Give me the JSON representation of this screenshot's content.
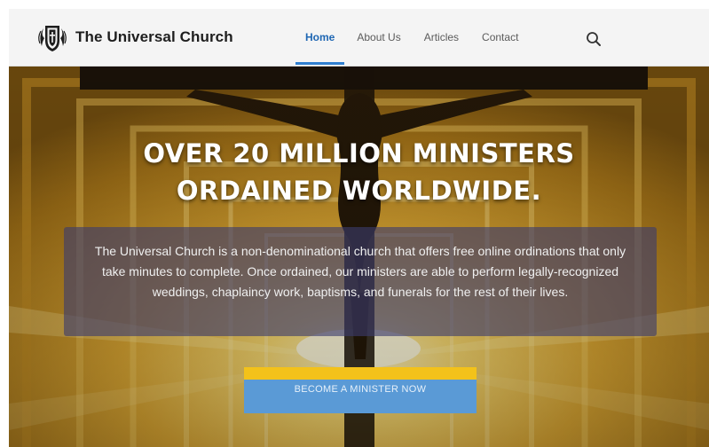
{
  "header": {
    "brand": "The Universal Church",
    "nav": [
      {
        "label": "Home",
        "active": true
      },
      {
        "label": "About Us",
        "active": false
      },
      {
        "label": "Articles",
        "active": false
      },
      {
        "label": "Contact",
        "active": false
      }
    ],
    "search_icon": "search-icon",
    "logo_icon": "church-crest-icon"
  },
  "hero": {
    "headline_line1": "OVER 20 MILLION MINISTERS",
    "headline_line2": "ORDAINED WORLDWIDE.",
    "description": "The Universal Church is a non-denominational church that offers free online ordinations that only take minutes to complete. Once ordained, our ministers are able to perform legally-recognized weddings, chaplaincy work, baptisms, and funerals for the rest of their lives.",
    "cta_label": "BECOME A MINISTER NOW"
  },
  "colors": {
    "nav_active": "#1f67b3",
    "cta_bg": "#5a9ad6",
    "cta_accent": "#f3c21a",
    "info_box": "rgba(60,60,110,0.62)"
  }
}
